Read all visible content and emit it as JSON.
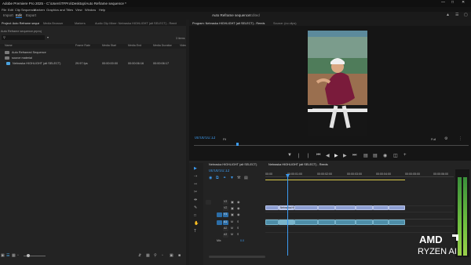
{
  "window": {
    "title": "Adobe Premiere Pro 2025 - C:\\Users\\TFPro\\Desktop\\Auto Reframe sequence *"
  },
  "menu": [
    "File",
    "Edit",
    "Clip",
    "Sequence",
    "Markers",
    "Graphics and Titles",
    "View",
    "Window",
    "Help"
  ],
  "workspace": {
    "tabs": [
      "Import",
      "Edit",
      "Export"
    ],
    "active": "Edit",
    "project_name": "Auto Reframe sequence",
    "edited": "Edited"
  },
  "project_panel": {
    "tabs": [
      "Project: Auto Reframe sequence",
      "Media Browser",
      "Markers",
      "Audio Clip Mixer: Nebraska HIGHLIGHT (alt SELECT) - Reeds",
      "Effect Controls"
    ],
    "path": "Auto Reframe sequence.prproj",
    "item_count": "3 items",
    "columns": [
      "Name",
      "Frame Rate",
      "Media Start",
      "Media End",
      "Media Duration",
      "Video In Point"
    ],
    "rows": [
      {
        "name": "Auto Reframed Sequence",
        "fps": "",
        "start": "",
        "end": "",
        "dur": ""
      },
      {
        "name": "source material",
        "fps": "",
        "start": "",
        "end": "",
        "dur": ""
      },
      {
        "name": "Nebraska HIGHLIGHT (alt SELECT)",
        "fps": "29.97 fps",
        "start": "00:00:00:00",
        "end": "00:00:06:16",
        "dur": "00:00:06:17"
      }
    ]
  },
  "program_monitor": {
    "tabs": [
      "Program: Nebraska HIGHLIGHT (alt SELECT) - Reeds",
      "Source: (no clips)"
    ],
    "timecode": "00:00:01:13",
    "fit": "Fit",
    "quality": "Full"
  },
  "timeline": {
    "tabs": [
      "Nebraska HIGHLIGHT (alt SELECT)",
      "Nebraska HIGHLIGHT (alt SELECT) - Reeds"
    ],
    "timecode": "00:00:01:13",
    "ruler": [
      "00:00",
      "00:00:01:00",
      "00:00:02:00",
      "00:00:03:00",
      "00:00:04:00",
      "00:00:05:00",
      "00:00:06:00"
    ],
    "video_tracks": [
      "V3",
      "V2",
      "V1"
    ],
    "audio_tracks": [
      "A1",
      "A2",
      "A3"
    ],
    "mix": "Mix",
    "mix_value": "0.0",
    "clip_label": "Nebraska HIGHLIGHT (alt SELECT)"
  },
  "branding": {
    "line1": "AMD",
    "line2": "RYZEN AI"
  },
  "colors": {
    "accent": "#2d8ceb",
    "timecode": "#3c9bf0",
    "playhead": "#3c9bf0",
    "video_clip": "#8e9fd3",
    "audio_clip": "#4e8ea8"
  }
}
